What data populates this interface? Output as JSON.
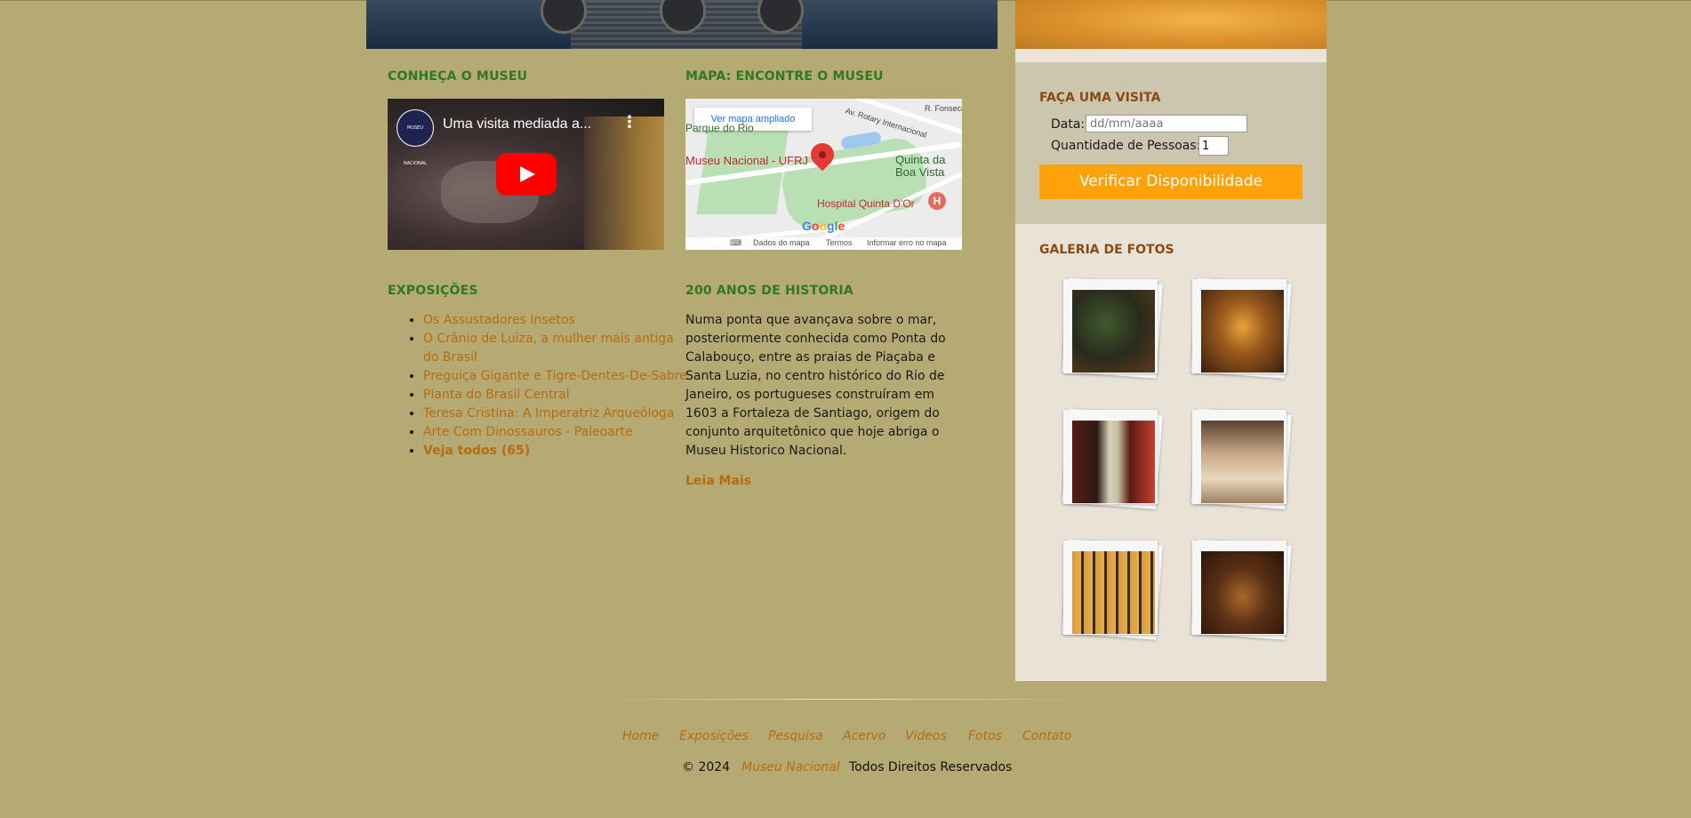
{
  "sections": {
    "conheca": "CONHEÇA O MUSEU",
    "mapa": "MAPA: ENCONTRE O MUSEU",
    "exposicoes": "EXPOSIÇÕES",
    "historia": "200 ANOS DE HISTORIA"
  },
  "video": {
    "title": "Uma visita mediada a...",
    "channel_logo": "MUSEU NACIONAL",
    "play_icon": "play-icon",
    "menu_icon": "more-vert-icon"
  },
  "map": {
    "enlarge": "Ver mapa ampliado",
    "labels": {
      "parque": "Parque do Rio",
      "museu": "Museu Nacional - UFRJ",
      "quinta": "Quinta da",
      "boa_vista": "Boa Vista",
      "hospital": "Hospital Quinta D'Or",
      "avenida": "Av. Rotary Internacional",
      "fonseca": "R. Fonseca"
    },
    "google": "Google",
    "footer": {
      "dados": "Dados do mapa",
      "termos": "Termos",
      "erro": "Informar erro no mapa"
    },
    "hospital_icon": "H"
  },
  "exposicoes": [
    "Os Assustadores Insetos",
    "O Crânio de Luiza, a mulher mais antiga do Brasil",
    "Preguiça Gigante e Tigre-Dentes-De-Sabre",
    "Planta do Brasil Central",
    "Teresa Cristina: A Imperatriz Arqueóloga",
    "Arte Com Dinossauros - Paleoarte",
    "Veja todos (65)"
  ],
  "historia": {
    "text": "Numa ponta que avançava sobre o mar, posteriormente conhecida como Ponta do Calabouço, entre as praias de Piaçaba e Santa Luzia, no centro histórico do Rio de Janeiro, os portugueses construíram em 1603 a Fortaleza de Santiago, origem do conjunto arquitetônico que hoje abriga o Museu Historico Nacional.",
    "more": "Leia Mais"
  },
  "visita": {
    "title": "FAÇA UMA VISITA",
    "date_label": "Data:",
    "date_placeholder": "dd/mm/aaaa",
    "qty_label": "Quantidade de Pessoas:",
    "qty_value": "1",
    "button": "Verificar Disponibilidade"
  },
  "galeria": {
    "title": "GALERIA DE FOTOS"
  },
  "footer": {
    "nav": [
      "Home",
      "Exposições",
      "Pesquisa",
      "Acervo",
      "Videos",
      "Fotos",
      "Contato"
    ],
    "copyright": "© 2024",
    "brand": "Museu Nacional",
    "rights": "Todos Direitos Reservados"
  },
  "colors": {
    "background": "#b5aa73",
    "section_title": "#2e7a1c",
    "link": "#b86b10",
    "button": "#ffa20a"
  }
}
